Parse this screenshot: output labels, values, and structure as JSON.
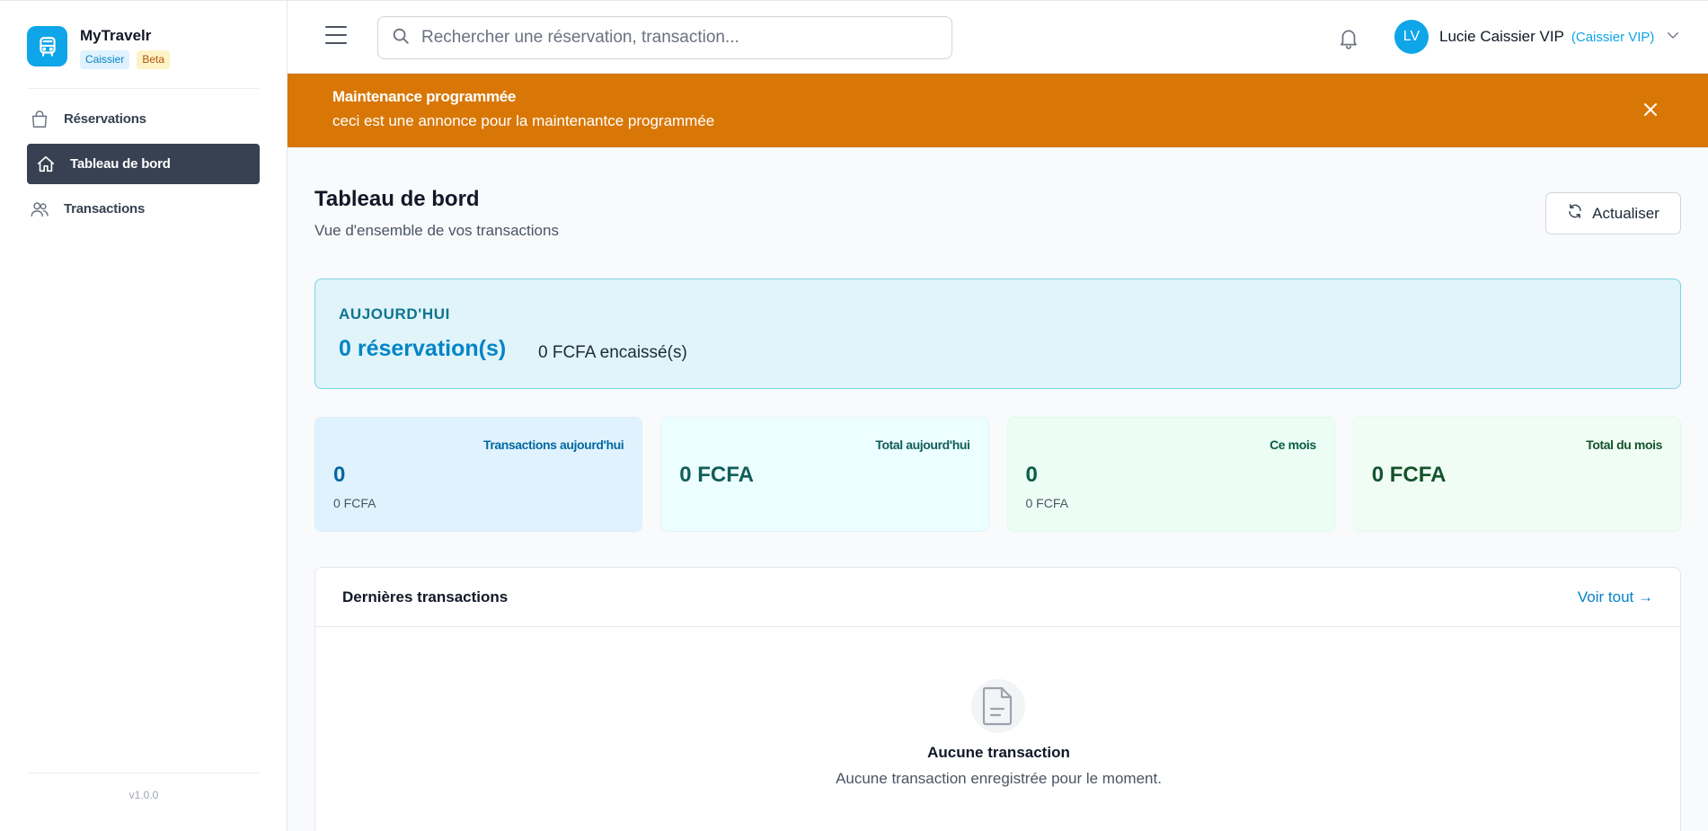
{
  "brand": {
    "name": "MyTravelr",
    "badges": [
      "Caissier",
      "Beta"
    ],
    "logo_icon": "bus-icon",
    "accent_color": "#0ea5e9"
  },
  "sidebar": {
    "items": [
      {
        "label": "Réservations",
        "icon": "bag-icon",
        "active": false
      },
      {
        "label": "Tableau de bord",
        "icon": "home-icon",
        "active": true
      },
      {
        "label": "Transactions",
        "icon": "users-icon",
        "active": false
      }
    ],
    "version": "v1.0.0"
  },
  "header": {
    "search_placeholder": "Rechercher une réservation, transaction...",
    "user": {
      "initials": "LV",
      "name": "Lucie Caissier VIP",
      "role": "(Caissier VIP)"
    }
  },
  "banner": {
    "title": "Maintenance programmée",
    "message": "ceci est une annonce pour la maintenantce programmée",
    "color": "#d97706"
  },
  "page": {
    "title": "Tableau de bord",
    "subtitle": "Vue d'ensemble de vos transactions",
    "refresh_label": "Actualiser"
  },
  "today": {
    "label": "AUJOURD'HUI",
    "reservations": "0 réservation(s)",
    "cashed": "0 FCFA encaissé(s)"
  },
  "stats": [
    {
      "label": "Transactions aujourd'hui",
      "value": "0",
      "sub": "0 FCFA"
    },
    {
      "label": "Total aujourd'hui",
      "value": "0 FCFA",
      "sub": ""
    },
    {
      "label": "Ce mois",
      "value": "0",
      "sub": "0 FCFA"
    },
    {
      "label": "Total du mois",
      "value": "0 FCFA",
      "sub": ""
    }
  ],
  "transactions": {
    "title": "Dernières transactions",
    "view_all": "Voir tout →",
    "empty_title": "Aucune transaction",
    "empty_message": "Aucune transaction enregistrée pour le moment."
  }
}
